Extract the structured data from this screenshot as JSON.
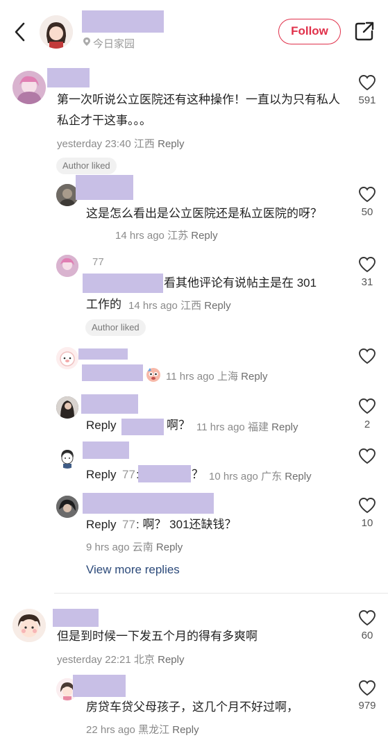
{
  "header": {
    "location": "今日家园",
    "follow_label": "Follow"
  },
  "comments": {
    "c1": {
      "text": "第一次听说公立医院还有这种操作！一直以为只有私人私企才干这事。。。",
      "time": "yesterday 23:40",
      "region": "江西",
      "reply": "Reply",
      "badge": "Author liked",
      "likes": "591"
    },
    "r1": {
      "text": "这是怎么看出是公立医院还是私立医院的呀？",
      "time": "14 hrs ago",
      "region": "江苏",
      "reply": "Reply",
      "likes": "50"
    },
    "r2": {
      "name_suffix": "77",
      "text_a": "看其他评论有说帖主是在 301",
      "text_b": "工作的",
      "time": "14 hrs ago",
      "region": "江西",
      "reply": "Reply",
      "badge": "Author liked",
      "likes": "31"
    },
    "r3": {
      "time": "11 hrs ago",
      "region": "上海",
      "reply": "Reply"
    },
    "r4": {
      "prefix": "Reply",
      "text": "啊？",
      "time": "11 hrs ago",
      "region": "福建",
      "reply": "Reply",
      "likes": "2"
    },
    "r5": {
      "prefix": "Reply",
      "name": "77",
      "colon": ":",
      "text": "？",
      "time": "10 hrs ago",
      "region": "广东",
      "reply": "Reply"
    },
    "r6": {
      "prefix": "Reply",
      "name": "77",
      "text": ": 啊？ 301还缺钱？",
      "time": "9 hrs ago",
      "region": "云南",
      "reply": "Reply",
      "likes": "10"
    },
    "view_more": "View more replies",
    "c2": {
      "text": "但是到时候一下发五个月的得有多爽啊",
      "time": "yesterday 22:21",
      "region": "北京",
      "reply": "Reply",
      "likes": "60"
    },
    "r7": {
      "text": "房贷车贷父母孩子，这几个月不好过啊，",
      "time": "22 hrs ago",
      "region": "黑龙江",
      "reply": "Reply",
      "likes": "979"
    }
  },
  "colors": {
    "follow": "#e0304a",
    "redaction": "#c8bfe6",
    "link": "#2c4a7a"
  }
}
